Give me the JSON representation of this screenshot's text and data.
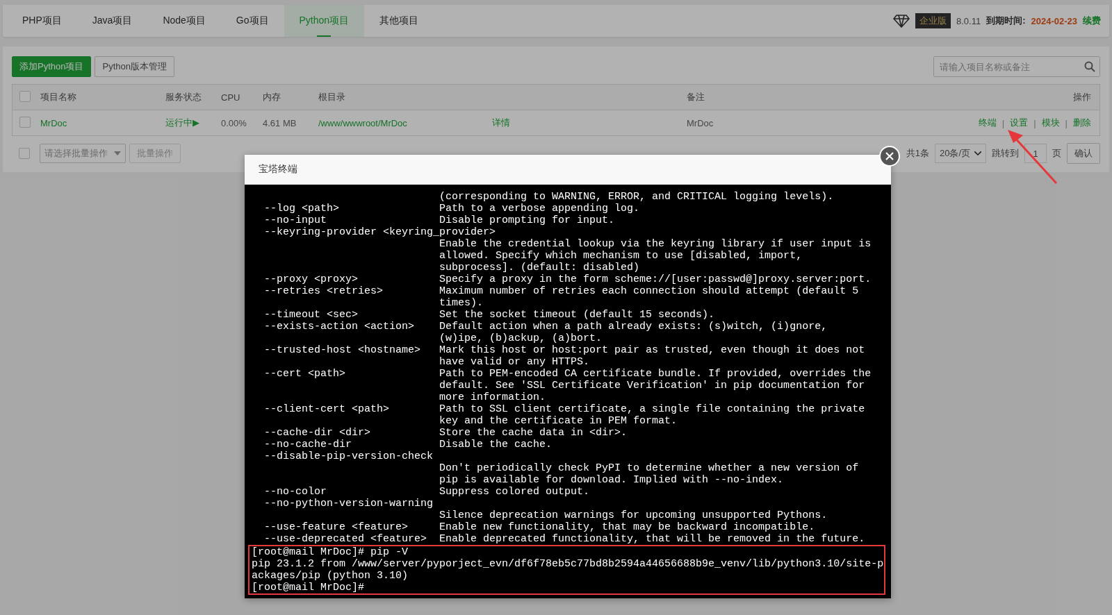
{
  "tabs": [
    {
      "label": "PHP项目",
      "selected": false
    },
    {
      "label": "Java项目",
      "selected": false
    },
    {
      "label": "Node项目",
      "selected": false
    },
    {
      "label": "Go项目",
      "selected": false
    },
    {
      "label": "Python项目",
      "selected": true
    },
    {
      "label": "其他项目",
      "selected": false
    }
  ],
  "header": {
    "edition": "企业版",
    "version": "8.0.11",
    "expiry_label": "到期时间:",
    "expiry_date": "2024-02-23",
    "renew": "续费"
  },
  "toolbar": {
    "add_button": "添加Python项目",
    "version_button": "Python版本管理",
    "search": {
      "placeholder": "请输入项目名称或备注"
    }
  },
  "table": {
    "header_checked": false,
    "columns": [
      "项目名称",
      "服务状态",
      "CPU",
      "内存",
      "根目录",
      "",
      "备注",
      "操作"
    ],
    "rows": [
      {
        "checked": false,
        "name": "MrDoc",
        "status": "运行中▶",
        "cpu": "0.00%",
        "memory": "4.61 MB",
        "root": "/www/wwwroot/MrDoc",
        "detail": "详情",
        "note": "MrDoc",
        "actions": [
          "终端",
          "设置",
          "模块",
          "删除"
        ],
        "action_separator": "|"
      }
    ]
  },
  "footer": {
    "checked": false,
    "batch_placeholder": "请选择批量操作",
    "batch_button": "批量操作",
    "total": "共1条",
    "page_size": "20条/页",
    "jump_label": "跳转到",
    "page": "1",
    "page_unit": "页",
    "confirm": "确认"
  },
  "modal": {
    "title": "宝塔终端",
    "lines": [
      "                              (corresponding to WARNING, ERROR, and CRITICAL logging levels).",
      "  --log <path>                Path to a verbose appending log.",
      "  --no-input                  Disable prompting for input.",
      "  --keyring-provider <keyring_provider>",
      "                              Enable the credential lookup via the keyring library if user input is",
      "                              allowed. Specify which mechanism to use [disabled, import,",
      "                              subprocess]. (default: disabled)",
      "  --proxy <proxy>             Specify a proxy in the form scheme://[user:passwd@]proxy.server:port.",
      "  --retries <retries>         Maximum number of retries each connection should attempt (default 5",
      "                              times).",
      "  --timeout <sec>             Set the socket timeout (default 15 seconds).",
      "  --exists-action <action>    Default action when a path already exists: (s)witch, (i)gnore,",
      "                              (w)ipe, (b)ackup, (a)bort.",
      "  --trusted-host <hostname>   Mark this host or host:port pair as trusted, even though it does not",
      "                              have valid or any HTTPS.",
      "  --cert <path>               Path to PEM-encoded CA certificate bundle. If provided, overrides the",
      "                              default. See 'SSL Certificate Verification' in pip documentation for",
      "                              more information.",
      "  --client-cert <path>        Path to SSL client certificate, a single file containing the private",
      "                              key and the certificate in PEM format.",
      "  --cache-dir <dir>           Store the cache data in <dir>.",
      "  --no-cache-dir              Disable the cache.",
      "  --disable-pip-version-check",
      "                              Don't periodically check PyPI to determine whether a new version of",
      "                              pip is available for download. Implied with --no-index.",
      "  --no-color                  Suppress colored output.",
      "  --no-python-version-warning",
      "                              Silence deprecation warnings for upcoming unsupported Pythons.",
      "  --use-feature <feature>     Enable new functionality, that may be backward incompatible.",
      "  --use-deprecated <feature>  Enable deprecated functionality, that will be removed in the future."
    ],
    "highlighted_lines": [
      "[root@mail MrDoc]# pip -V",
      "pip 23.1.2 from /www/server/pyporject_evn/df6f78eb5c77bd8b2594a44656688b9e_venv/lib/python3.10/site-p",
      "ackages/pip (python 3.10)",
      "[root@mail MrDoc]#"
    ]
  }
}
